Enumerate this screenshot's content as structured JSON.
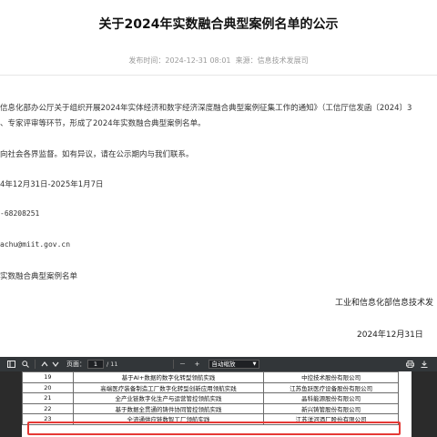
{
  "article": {
    "title": "关于2024年实数融合典型案例名单的公示",
    "meta": {
      "publish_label": "发布时间：",
      "publish_time": "2024-12-31 08:01",
      "source_label": "来源：",
      "source": "信息技术发展司"
    },
    "paragraph1_line1": "信息化部办公厅关于组织开展2024年实体经济和数字经济深度融合典型案例征集工作的通知》（工信厅信发函〔2024〕3",
    "paragraph1_line2": "、专家评审等环节，形成了2024年实数融合典型案例名单。",
    "paragraph2": "向社会各界监督。如有异议，请在公示期内与我们联系。",
    "period": "4年12月31日-2025年1月7日",
    "phone": "-68208251",
    "email": "achu@miit.gov.cn",
    "attachment": "实数融合典型案例名单",
    "sign_org": "工业和信息化部信息技术发",
    "sign_date": "2024年12月31日"
  },
  "viewer": {
    "toolbar": {
      "page_label": "页面：",
      "page_current": "1",
      "page_total": "/ 11",
      "zoom_minus": "－",
      "zoom_plus": "+",
      "zoom_value": "自动缩放",
      "icons": [
        "sidebar-toggle-icon",
        "search-icon",
        "prev-page-icon",
        "next-page-icon",
        "zoom-out-icon",
        "zoom-in-icon",
        "print-icon",
        "download-icon"
      ]
    },
    "table_rows": [
      {
        "no": "19",
        "name": "基于AI+数据的数字化转型领航实践",
        "org": "中控技术股份有限公司"
      },
      {
        "no": "20",
        "name": "高端医疗装备制造工厂数字化转型创新应用领航实践",
        "org": "江苏鱼跃医疗设备股份有限公司"
      },
      {
        "no": "21",
        "name": "全产业链数字化生产与运营管控领航实践",
        "org": "晶科能源股份有限公司"
      },
      {
        "no": "22",
        "name": "基于数据全贯通的铸件协同管控领航实践",
        "org": "新兴铸管股份有限公司"
      },
      {
        "no": "23",
        "name": "全流通供应链数智工厂领航实践",
        "org": "江苏洋河酒厂股份有限公司"
      }
    ],
    "highlight_color": "#e53935",
    "toolbar_color": "#323639"
  }
}
